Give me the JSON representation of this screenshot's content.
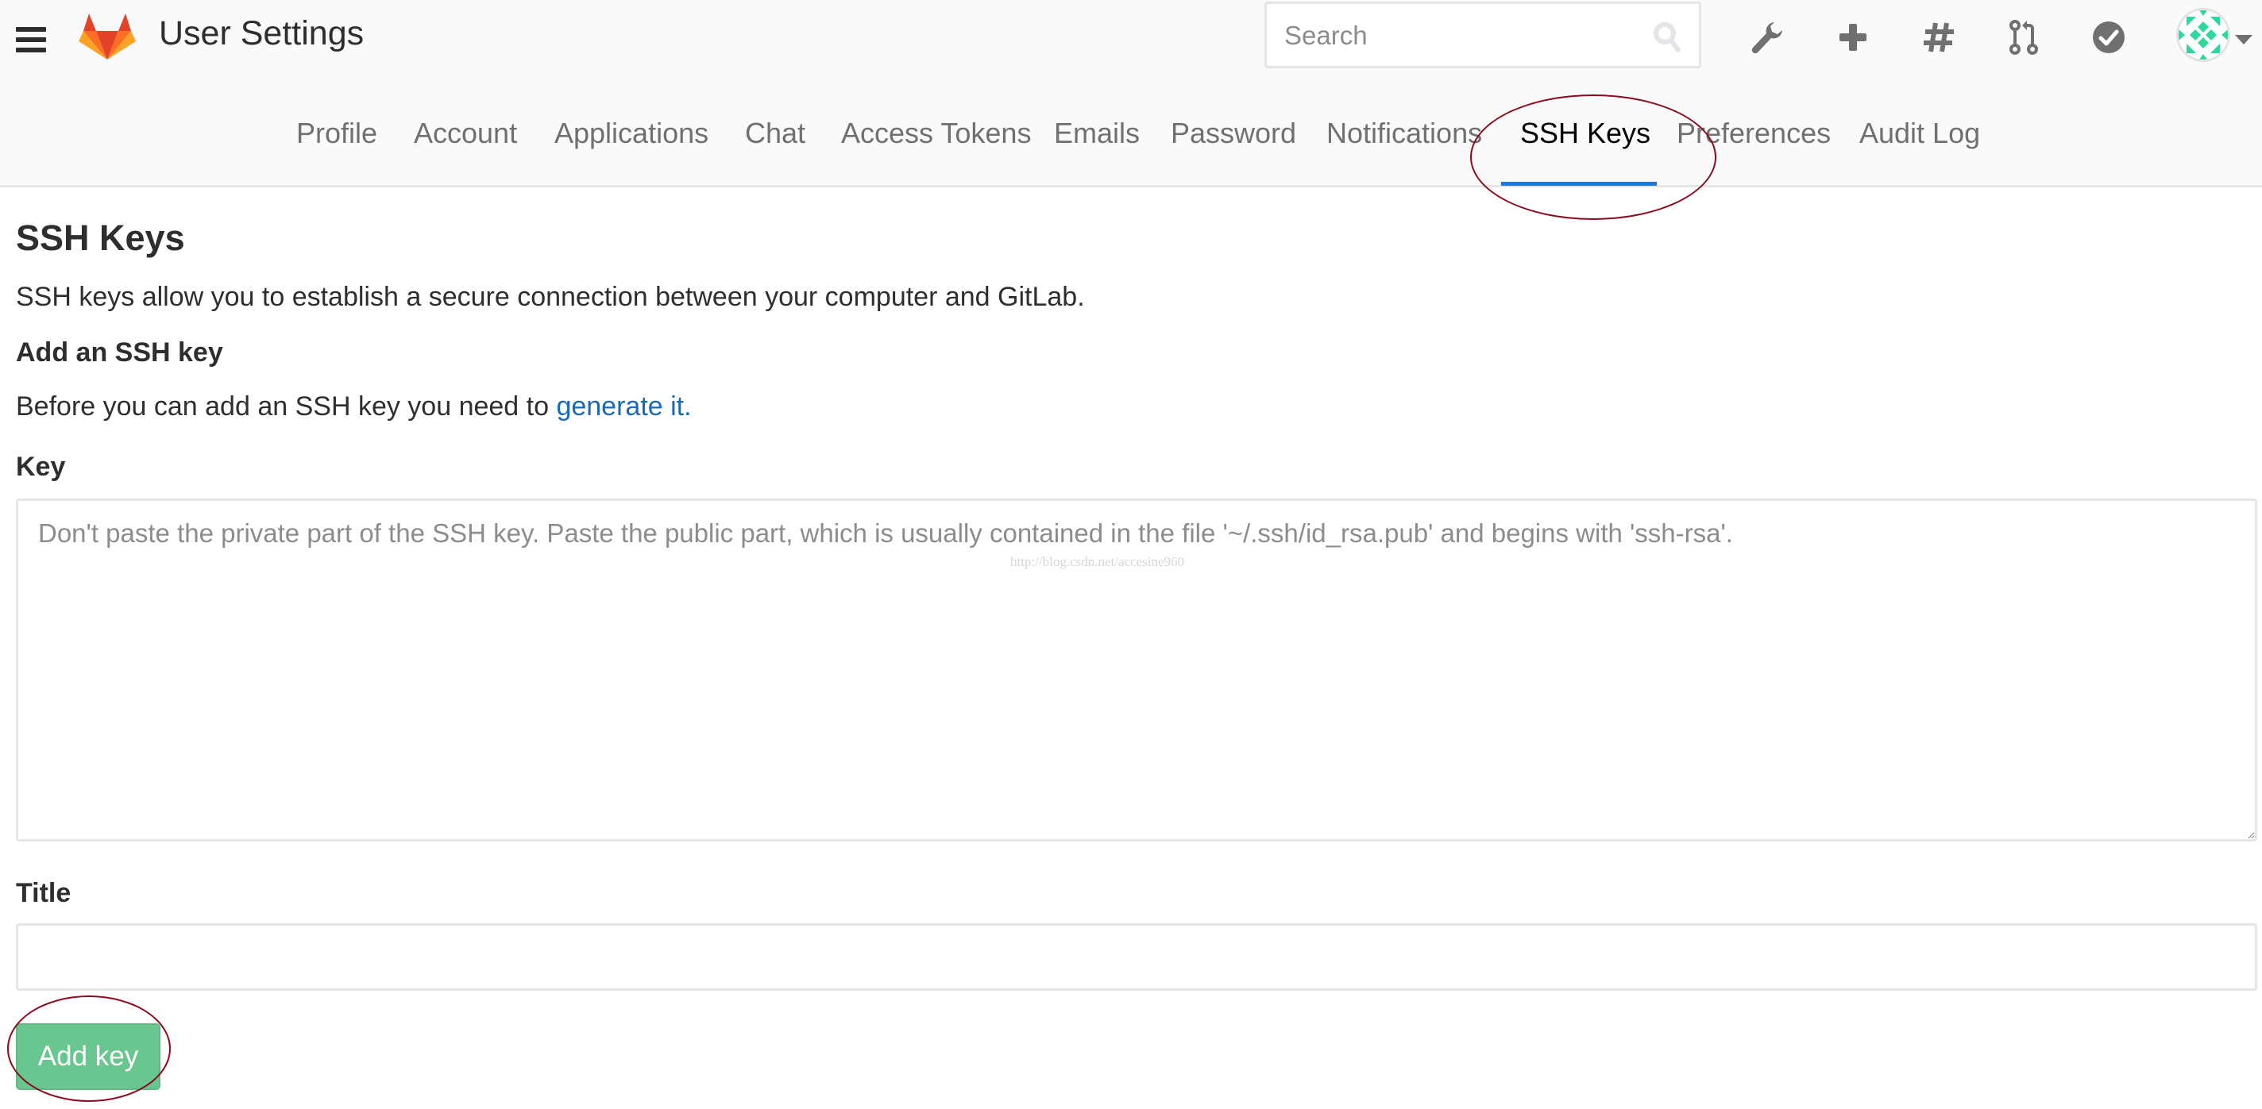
{
  "header": {
    "title": "User Settings",
    "search": {
      "placeholder": "Search",
      "value": ""
    },
    "icons": [
      "admin-wrench-icon",
      "new-plus-icon",
      "issues-hash-icon",
      "merge-requests-icon",
      "todos-check-icon"
    ],
    "avatar_caret": "caret-down-icon"
  },
  "tabs": [
    {
      "label": "Profile",
      "active": false
    },
    {
      "label": "Account",
      "active": false
    },
    {
      "label": "Applications",
      "active": false
    },
    {
      "label": "Chat",
      "active": false
    },
    {
      "label": "Access Tokens",
      "active": false
    },
    {
      "label": "Emails",
      "active": false
    },
    {
      "label": "Password",
      "active": false
    },
    {
      "label": "Notifications",
      "active": false
    },
    {
      "label": "SSH Keys",
      "active": true
    },
    {
      "label": "Preferences",
      "active": false
    },
    {
      "label": "Audit Log",
      "active": false
    }
  ],
  "main": {
    "title": "SSH Keys",
    "intro": "SSH keys allow you to establish a secure connection between your computer and GitLab.",
    "section_title": "Add an SSH key",
    "before_text": "Before you can add an SSH key you need to ",
    "generate_link": "generate it.",
    "key_label": "Key",
    "key_placeholder": "Don't paste the private part of the SSH key. Paste the public part, which is usually contained in the file '~/.ssh/id_rsa.pub' and begins with 'ssh-rsa'.",
    "key_value": "",
    "title_label": "Title",
    "title_value": "",
    "add_button": "Add key",
    "watermark": "http://blog.csdn.net/accesine960"
  },
  "colors": {
    "accent": "#1f78d1",
    "link": "#1b69b6",
    "success": "#69c68f",
    "annotation": "#8b0a1e"
  }
}
